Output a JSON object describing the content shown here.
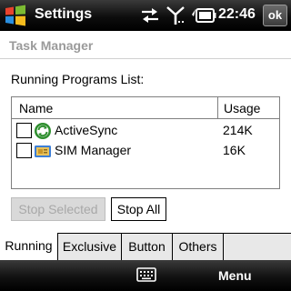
{
  "titlebar": {
    "title": "Settings",
    "time": "22:46",
    "ok_label": "ok",
    "icons": [
      "windows-start-icon",
      "sync-arrows-icon",
      "signal-strength-icon",
      "battery-icon"
    ]
  },
  "page": {
    "header": "Task Manager",
    "list_caption": "Running Programs List:"
  },
  "listview": {
    "columns": [
      "Name",
      "Usage"
    ],
    "rows": [
      {
        "name": "ActiveSync",
        "usage": "214K",
        "checked": false,
        "icon": "activesync-icon"
      },
      {
        "name": "SIM Manager",
        "usage": "16K",
        "checked": false,
        "icon": "sim-manager-icon"
      }
    ]
  },
  "buttons": {
    "stop_selected": "Stop Selected",
    "stop_all": "Stop All"
  },
  "tabs": [
    {
      "label": "Running",
      "active": true
    },
    {
      "label": "Exclusive",
      "active": false
    },
    {
      "label": "Button",
      "active": false
    },
    {
      "label": "Others",
      "active": false
    }
  ],
  "softkeys": {
    "right": "Menu",
    "center_icon": "keyboard-icon"
  },
  "colors": {
    "bar_dark": "#000000",
    "header_text": "#9a9a9a",
    "disabled_button": "#d9d9d9",
    "activesync_green": "#2f8f2f"
  }
}
